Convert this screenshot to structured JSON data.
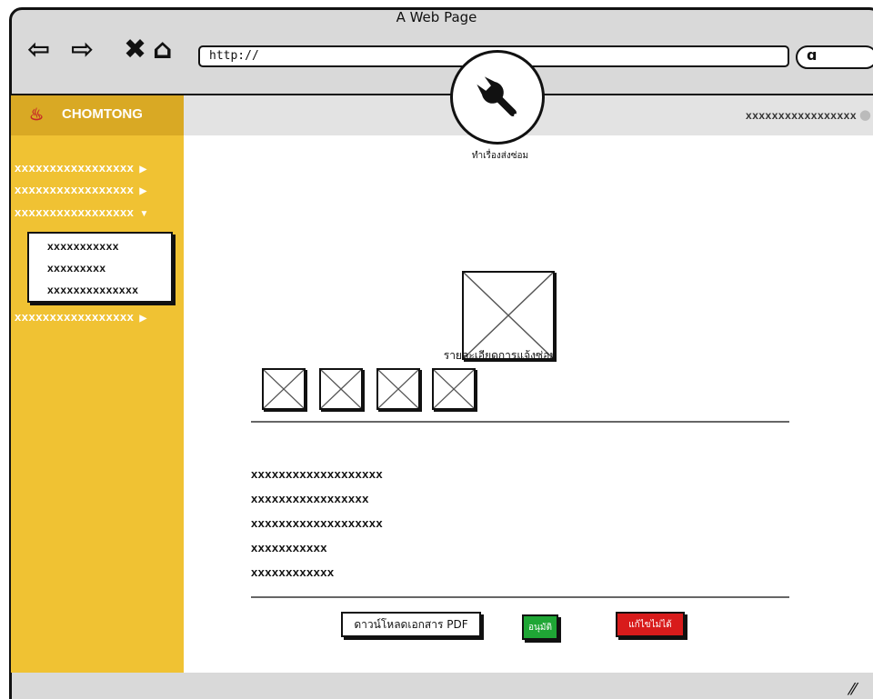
{
  "browser": {
    "title": "A Web Page",
    "url": "http://",
    "nav_icons": [
      "back-arrow-icon",
      "forward-arrow-icon",
      "close-icon",
      "home-icon"
    ]
  },
  "brand": {
    "name": "CHOMTONG",
    "logo_icon": "crest-logo-icon"
  },
  "sidebar": {
    "items": [
      {
        "label": "xxxxxxxxxxxxxxxxx",
        "arrow": "▶"
      },
      {
        "label": "xxxxxxxxxxxxxxxxx",
        "arrow": "▶"
      },
      {
        "label": "xxxxxxxxxxxxxxxxx",
        "arrow": "▼"
      },
      {
        "label": "xxxxxxxxxxxxxxxxx",
        "arrow": "▶"
      }
    ],
    "submenu": [
      "xxxxxxxxxxx",
      "xxxxxxxxx",
      "xxxxxxxxxxxxxx"
    ]
  },
  "header": {
    "user_name": "xxxxxxxxxxxxxxxxx",
    "user_icon": "user-icon"
  },
  "main": {
    "tool_icon": "wrench-icon",
    "caption": "ทำเรื่องส่งซ่อม",
    "section_title": "รายละเอียดการแจ้งซ่อม",
    "details": [
      "xxxxxxxxxxxxxxxxxxx",
      "xxxxxxxxxxxxxxxxx",
      "xxxxxxxxxxxxxxxxxxx",
      "xxxxxxxxxxx",
      "xxxxxxxxxxxx"
    ],
    "buttons": {
      "download": "ดาวน์โหลดเอกสาร PDF",
      "approve": "อนุมัติ",
      "reject": "แก้ไขไม่ได้"
    }
  },
  "colors": {
    "sidebar": "#f0c233",
    "brand_bar": "#d9a924",
    "approve": "#1fa635",
    "reject": "#d81b1b",
    "chrome": "#d9d9d9"
  }
}
